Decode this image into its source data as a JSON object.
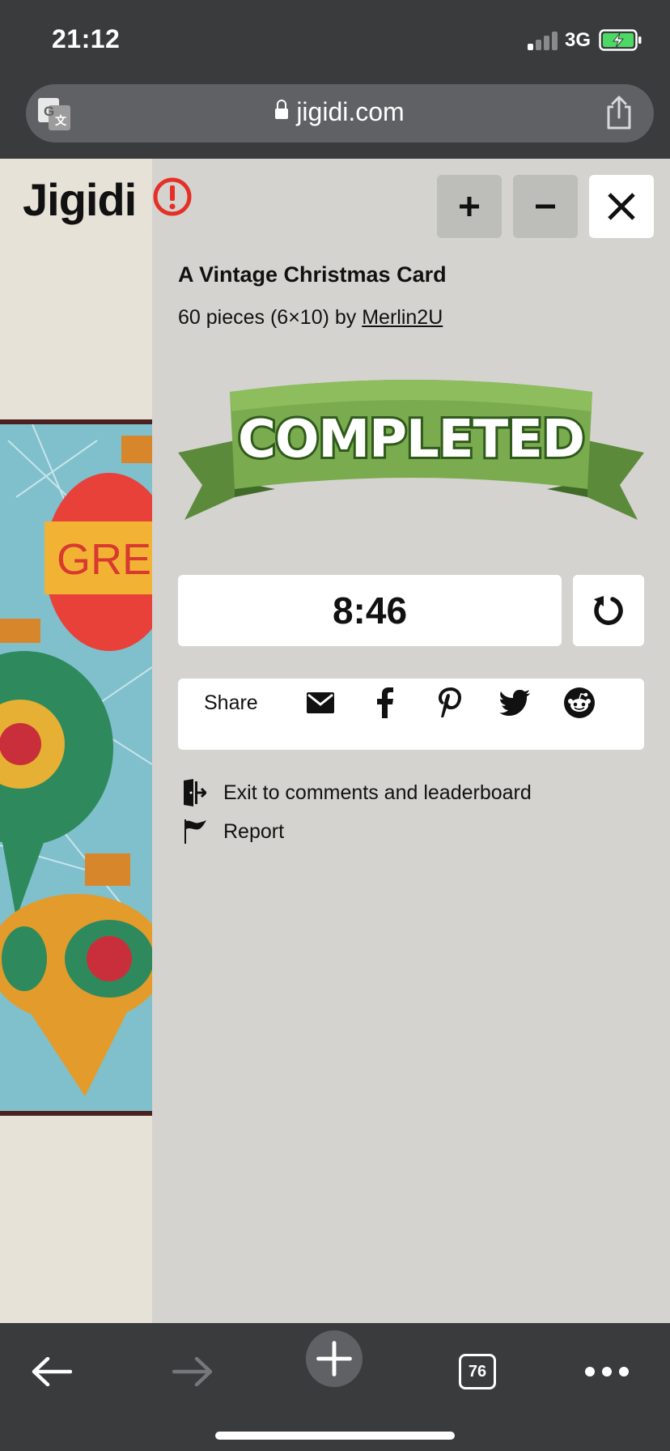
{
  "status": {
    "time": "21:12",
    "network": "3G"
  },
  "browser": {
    "url": "jigidi.com",
    "tabs_count": "76"
  },
  "app": {
    "brand": "Jigidi"
  },
  "puzzle": {
    "title": "A Vintage Christmas Card",
    "meta_prefix": "60 pieces (6×10) by",
    "author": "Merlin2U",
    "banner_text": "COMPLETED",
    "time": "8:46",
    "ornament_text": "GREET"
  },
  "share": {
    "label": "Share",
    "icons": [
      "mail-icon",
      "facebook-icon",
      "pinterest-icon",
      "twitter-icon",
      "reddit-icon"
    ]
  },
  "links": {
    "exit": "Exit to comments and leaderboard",
    "report": "Report"
  },
  "colors": {
    "chrome": "#3a3b3d",
    "panel": "#d4d3cf",
    "ribbon_green": "#6a9a45",
    "alert_red": "#e53026"
  }
}
